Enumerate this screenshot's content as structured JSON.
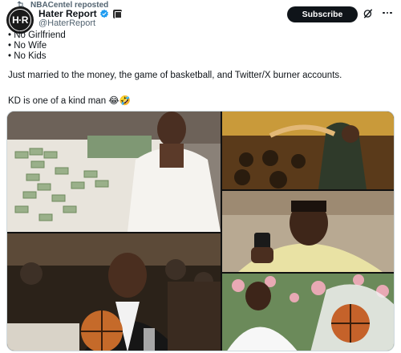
{
  "repost": {
    "text": "NBACentel reposted"
  },
  "author": {
    "avatar_text": "H·R",
    "display_name": "Hater Report",
    "handle": "@HaterReport",
    "verified_color": "#1d9bf0"
  },
  "actions": {
    "subscribe_label": "Subscribe",
    "icons": [
      "grok-icon",
      "more-options-icon"
    ]
  },
  "post": {
    "bullets": [
      "• No Girlfriend",
      "• No Wife",
      "• No Kids"
    ],
    "paragraph": "Just married to the money, the game of basketball, and Twitter/X burner accounts.",
    "closing": "KD is one of a kind man 😂🤣"
  },
  "media": {
    "tiles": [
      "photo-bed-money",
      "photo-crowd",
      "photo-phone",
      "photo-dinner",
      "photo-wedding"
    ]
  }
}
